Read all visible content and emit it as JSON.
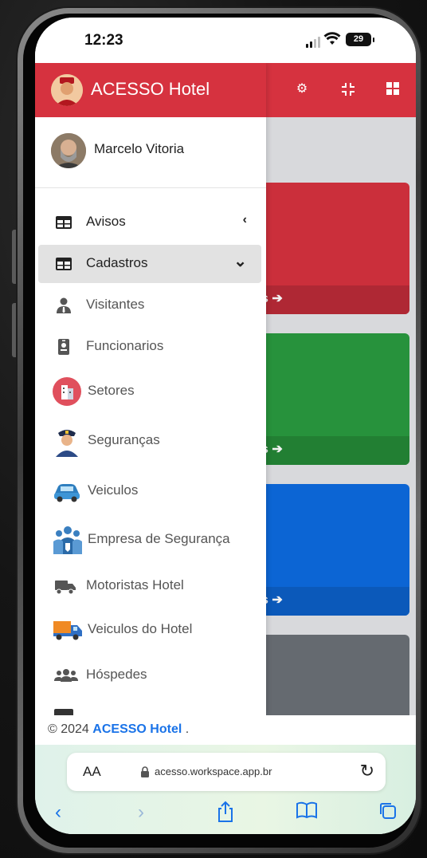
{
  "status_bar": {
    "time": "12:23",
    "battery": "29"
  },
  "app": {
    "brand": "ACESSO Hotel"
  },
  "user": {
    "name": "Marcelo Vitoria"
  },
  "menu": {
    "items": [
      {
        "label": "Avisos",
        "chevron": "‹",
        "icon": "table-icon"
      },
      {
        "label": "Cadastros",
        "chevron": "⌄",
        "icon": "table-icon",
        "active": true
      },
      {
        "label": "Visitantes",
        "icon": "user-tie-icon"
      },
      {
        "label": "Funcionarios",
        "icon": "id-badge-icon"
      },
      {
        "label": "Setores",
        "icon": "building-icon"
      },
      {
        "label": "Seguranças",
        "icon": "police-icon"
      },
      {
        "label": "Veiculos",
        "icon": "car-icon"
      },
      {
        "label": "Empresa de Segurança",
        "icon": "people-icon"
      },
      {
        "label": "Motoristas Hotel",
        "icon": "truck-icon"
      },
      {
        "label": "Veiculos do Hotel",
        "icon": "delivery-truck-icon"
      },
      {
        "label": "Hóspedes",
        "icon": "users-icon"
      }
    ]
  },
  "cards": [
    {
      "more": "s ➔",
      "color": "#d6323f",
      "footer": "#b92b37"
    },
    {
      "more": "s ➔",
      "color": "#2a9a40",
      "footer": "#248636"
    },
    {
      "more": "s ➔",
      "color": "#0d6be0",
      "footer": "#0c5ec4"
    },
    {
      "color": "#6b7077"
    }
  ],
  "footer": {
    "prefix": "© 2024 ",
    "brand": "ACESSO Hotel",
    "suffix": " ."
  },
  "safari": {
    "aa": "AA",
    "url": "acesso.workspace.app.br"
  }
}
